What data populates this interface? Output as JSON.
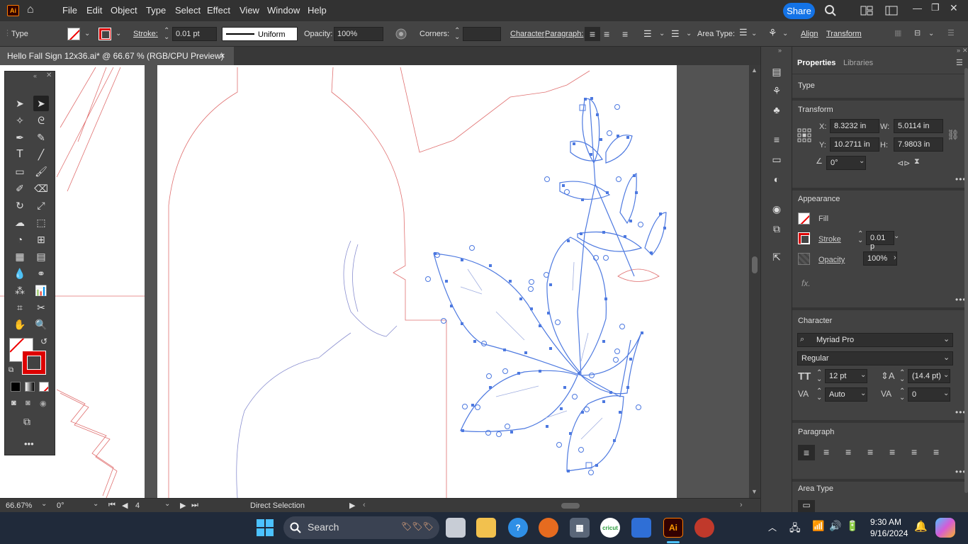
{
  "app": {
    "logo": "Ai"
  },
  "menu": [
    "File",
    "Edit",
    "Object",
    "Type",
    "Select",
    "Effect",
    "View",
    "Window",
    "Help"
  ],
  "share_label": "Share",
  "control_bar": {
    "selection_type": "Type",
    "stroke_label": "Stroke:",
    "stroke_value": "0.01 pt",
    "stroke_profile": "Uniform",
    "opacity_label": "Opacity:",
    "opacity_value": "100%",
    "corners_label": "Corners:",
    "character_label": "Character",
    "paragraph_label": "Paragraph:",
    "area_type_label": "Area Type:",
    "align_label": "Align",
    "transform_label": "Transform"
  },
  "document_tab": {
    "title": "Hello Fall Sign 12x36.ai* @ 66.67 % (RGB/CPU Preview)",
    "close": "×"
  },
  "status_bar": {
    "zoom": "66.67%",
    "rotation": "0°",
    "artboard": "4",
    "tool": "Direct Selection"
  },
  "properties": {
    "tabs": [
      "Properties",
      "Libraries"
    ],
    "object_type": "Type",
    "transform": {
      "title": "Transform",
      "x_label": "X:",
      "x": "8.3232 in",
      "y_label": "Y:",
      "y": "10.2711 in",
      "w_label": "W:",
      "w": "5.0114 in",
      "h_label": "H:",
      "h": "7.9803 in",
      "angle": "0°"
    },
    "appearance": {
      "title": "Appearance",
      "fill_label": "Fill",
      "stroke_label": "Stroke",
      "stroke_value": "0.01 p",
      "opacity_label": "Opacity",
      "opacity_value": "100%",
      "fx_label": "fx."
    },
    "character": {
      "title": "Character",
      "font_family": "Myriad Pro",
      "font_style": "Regular",
      "font_size": "12 pt",
      "leading": "(14.4 pt)",
      "kerning": "Auto",
      "tracking": "0"
    },
    "paragraph": {
      "title": "Paragraph"
    },
    "area_type": {
      "title": "Area Type"
    }
  },
  "taskbar": {
    "search_label": "Search",
    "time": "9:30 AM",
    "date": "9/16/2024"
  },
  "colors": {
    "selection_blue": "#4d79e0",
    "guide_red": "#e04040",
    "accent": "#1473e6"
  }
}
